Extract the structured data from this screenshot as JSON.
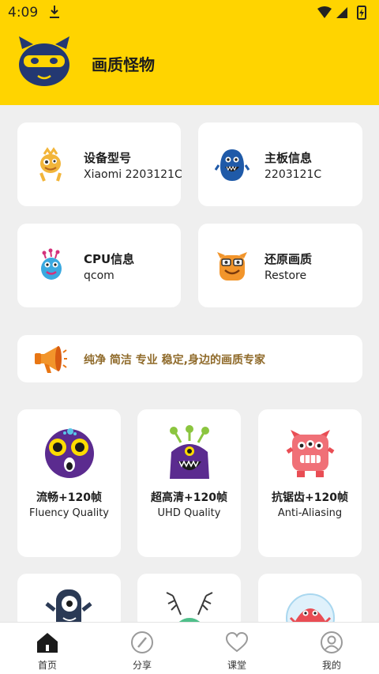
{
  "status_bar": {
    "time": "4:09"
  },
  "header": {
    "title": "画质怪物"
  },
  "info_cards": [
    {
      "title": "设备型号",
      "value": "Xiaomi 2203121C"
    },
    {
      "title": "主板信息",
      "value": "2203121C"
    },
    {
      "title": "CPU信息",
      "value": "qcom"
    },
    {
      "title": "还原画质",
      "value": "Restore"
    }
  ],
  "banner": {
    "text": "纯净 简洁 专业 稳定,身边的画质专家"
  },
  "features": [
    {
      "title": "流畅+120帧",
      "subtitle": "Fluency Quality"
    },
    {
      "title": "超高清+120帧",
      "subtitle": "UHD Quality"
    },
    {
      "title": "抗锯齿+120帧",
      "subtitle": "Anti-Aliasing"
    }
  ],
  "tabs": [
    {
      "label": "首页",
      "icon": "home-icon"
    },
    {
      "label": "分享",
      "icon": "compass-icon"
    },
    {
      "label": "课堂",
      "icon": "heart-icon"
    },
    {
      "label": "我的",
      "icon": "profile-icon"
    }
  ],
  "colors": {
    "header_bg": "#ffd400",
    "banner_text": "#8f6a2a",
    "page_bg": "#efefef"
  }
}
